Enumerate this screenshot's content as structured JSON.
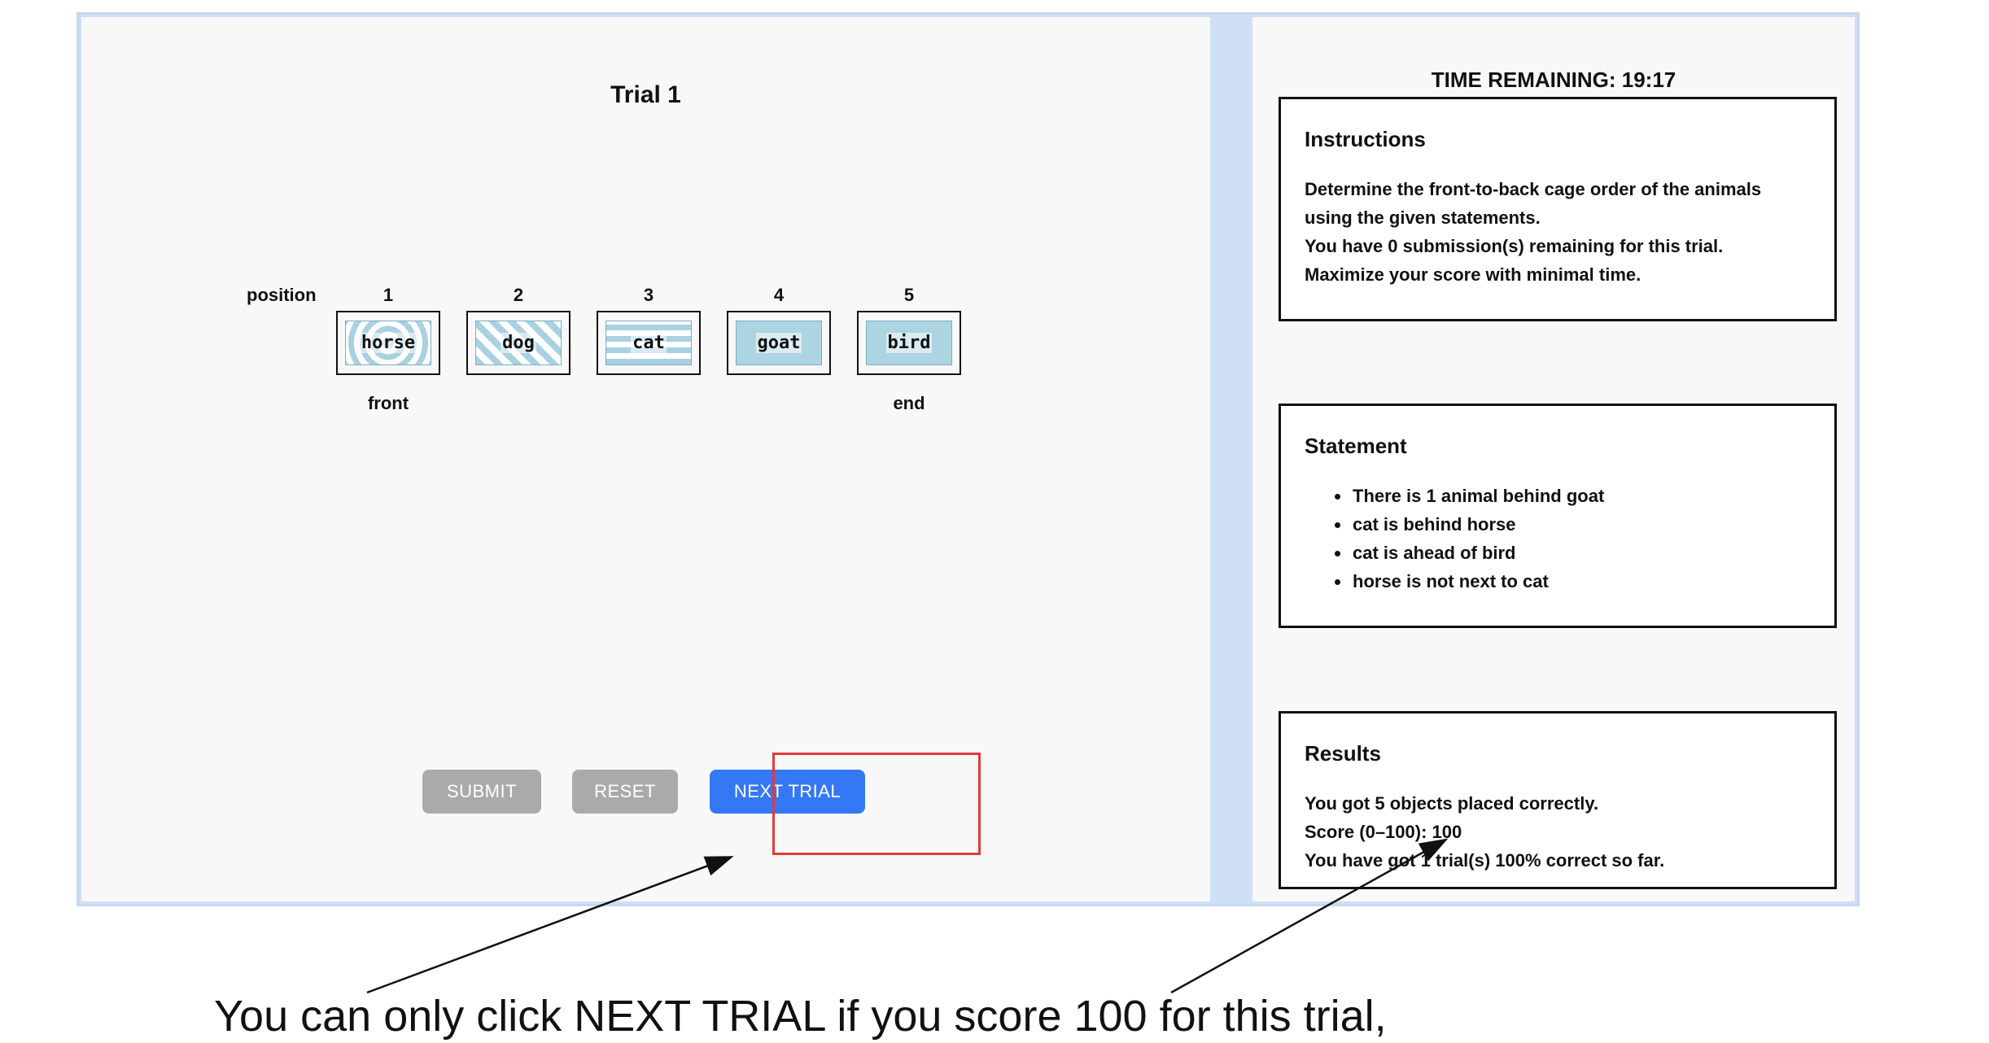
{
  "trial": {
    "title": "Trial 1"
  },
  "positions": {
    "label": "position",
    "numbers": [
      "1",
      "2",
      "3",
      "4",
      "5"
    ],
    "front_label": "front",
    "end_label": "end"
  },
  "cages": [
    {
      "animal": "horse",
      "pattern": "concentric-circles"
    },
    {
      "animal": "dog",
      "pattern": "diagonal-stripes"
    },
    {
      "animal": "cat",
      "pattern": "horizontal-stripes"
    },
    {
      "animal": "goat",
      "pattern": "solid"
    },
    {
      "animal": "bird",
      "pattern": "checkered"
    }
  ],
  "buttons": {
    "submit": "SUBMIT",
    "reset": "RESET",
    "next_trial": "NEXT TRIAL"
  },
  "sidebar": {
    "timer": "TIME REMAINING: 19:17",
    "instructions": {
      "title": "Instructions",
      "lines": [
        "Determine the front-to-back cage order of the animals",
        "using the given statements.",
        "You have 0 submission(s) remaining for this trial.",
        "Maximize your score with minimal time."
      ]
    },
    "statement": {
      "title": "Statement",
      "items": [
        "There is 1 animal behind goat",
        "cat is behind horse",
        "cat is ahead of bird",
        "horse is not next to cat"
      ]
    },
    "results": {
      "title": "Results",
      "lines": [
        "You got 5 objects placed correctly.",
        "Score (0–100): 100",
        "You have got 1 trial(s) 100% correct so far."
      ]
    }
  },
  "annotation": {
    "caption": "You can only click NEXT TRIAL if you score 100 for this trial,"
  },
  "colors": {
    "primary_button": "#3478f6",
    "disabled_button": "#aaaaaa",
    "highlight": "#e03b3b",
    "pattern": "#a9d1e0"
  }
}
